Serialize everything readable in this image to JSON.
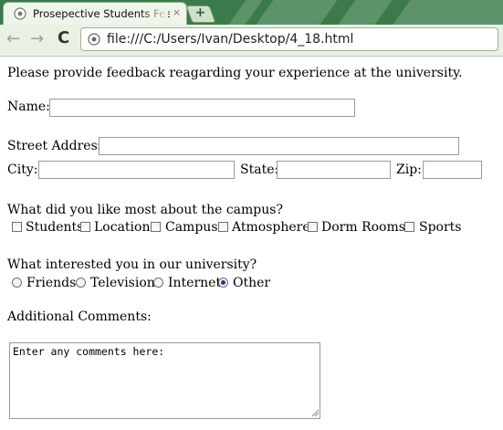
{
  "browser": {
    "tab_title": "Prosepective Students Feedback",
    "tab_close": "×",
    "new_tab": "+",
    "back": "←",
    "forward": "→",
    "reload": "C",
    "url": "file:///C:/Users/Ivan/Desktop/4_18.html"
  },
  "form": {
    "intro": "Please provide feedback reagarding your experience at the university.",
    "name_label": "Name:",
    "street_label": "Street Address:",
    "city_label": "City:",
    "state_label": "State:",
    "zip_label": "Zip:",
    "liked_question": "What did you like most about the campus?",
    "liked_options": [
      {
        "label": "Students",
        "checked": false
      },
      {
        "label": "Location",
        "checked": false
      },
      {
        "label": "Campus",
        "checked": false
      },
      {
        "label": "Atmosphere",
        "checked": false
      },
      {
        "label": "Dorm Rooms",
        "checked": false
      },
      {
        "label": "Sports",
        "checked": false
      }
    ],
    "interest_question": "What interested you in our university?",
    "interest_options": [
      {
        "label": "Friends",
        "selected": false
      },
      {
        "label": "Television",
        "selected": false
      },
      {
        "label": "Internet",
        "selected": false
      },
      {
        "label": "Other",
        "selected": true
      }
    ],
    "comments_label": "Additional Comments:",
    "comments_value": "Enter any comments here:"
  }
}
